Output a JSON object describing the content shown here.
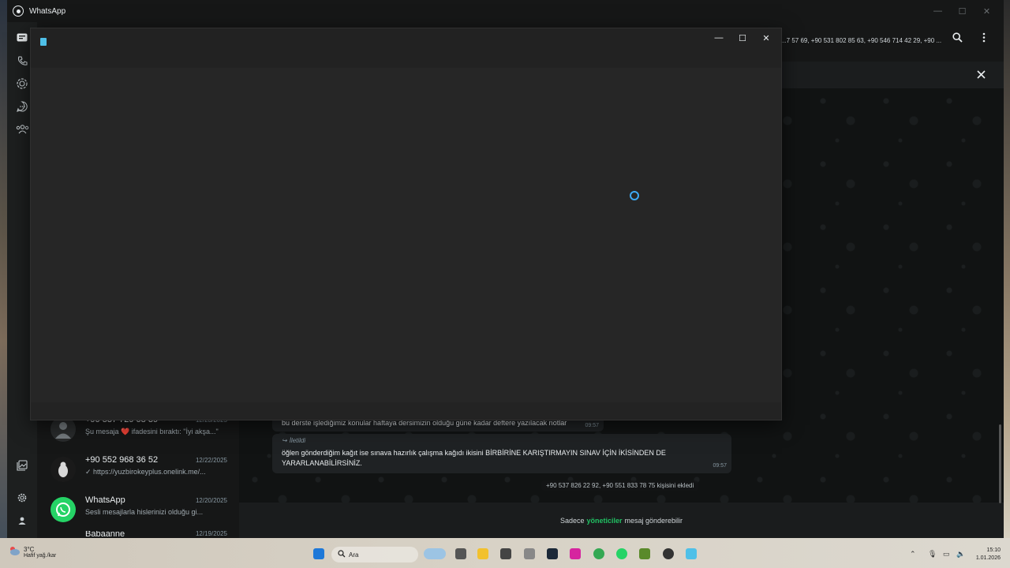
{
  "window": {
    "title": "WhatsApp",
    "controls": {
      "minimize": "—",
      "maximize": "☐",
      "close": "✕"
    }
  },
  "nav_rail": {
    "icons": [
      "chats-icon",
      "calls-icon",
      "status-icon",
      "channels-icon",
      "communities-icon",
      "media-icon",
      "settings-icon",
      "profile-icon"
    ]
  },
  "chat_list": {
    "items": [
      {
        "name": "+90 537 729 08 39",
        "date": "12/23/2025",
        "preview": "Şu mesaja ❤️ ifadesini bıraktı: \"İyi akşa...\""
      },
      {
        "name": "+90 552 968 36 52",
        "date": "12/22/2025",
        "preview": "✓ https://yuzbirokeyplus.onelink.me/..."
      },
      {
        "name": "WhatsApp",
        "date": "12/20/2025",
        "preview": "Sesli mesajlarla hislerinizi olduğu gi..."
      },
      {
        "name": "Babaanne",
        "date": "12/19/2025",
        "preview": ""
      }
    ]
  },
  "conversation": {
    "participants": "...7 57 69, +90 531 802 85 63, +90 546 714 42 29, +90 ...",
    "messages": [
      {
        "text": "bu derste işlediğimiz konular haftaya dersimizin olduğu güne kadar deftere yazılacak notlar",
        "time": "09:57"
      },
      {
        "forwarded_label": "İletildi",
        "text": "öğlen gönderdiğim kağıt ise sınava hazırlık çalışma kağıdı ikisini BİRBİRİNE KARIŞTIRMAYIN SINAV İÇİN İKİSİNDEN DE YARARLANABİLİRSİNİZ.",
        "time": "09:57"
      }
    ],
    "system_note": "+90 537 826 22 92, +90 551 833 78 75 kişisini ekledi",
    "footer": {
      "before": "Sadece",
      "highlight": "yöneticiler",
      "after": "mesaj gönderebilir"
    }
  },
  "dialog": {
    "controls": {
      "minimize": "—",
      "maximize": "☐",
      "close": "✕"
    }
  },
  "taskbar": {
    "weather": {
      "temp": "3°C",
      "condition": "Hafif yağ./kar"
    },
    "search_label": "Ara",
    "time": "15:10",
    "date": "1.01.2026"
  },
  "colors": {
    "accent_green": "#21c063",
    "spinner_blue": "#3da9f5"
  }
}
